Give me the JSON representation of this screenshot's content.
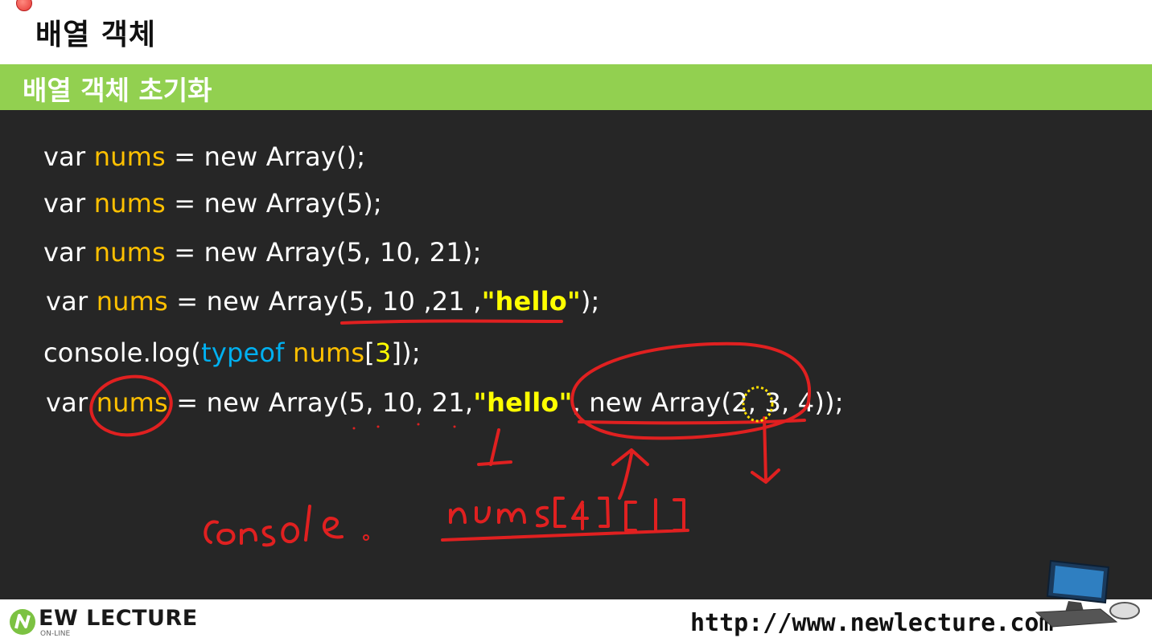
{
  "slide": {
    "title": "배열 객체",
    "section_title": "배열 객체 초기화"
  },
  "code": {
    "line1": {
      "var": "var",
      "name": "nums",
      "rest": " = new Array();"
    },
    "line2": {
      "var": "var",
      "name": "nums",
      "rest": " = new Array(5);"
    },
    "line3": {
      "var": "var",
      "name": "nums",
      "rest": " = new Array(5, 10, 21);"
    },
    "line4": {
      "var": "var",
      "name": "nums",
      "pre": " = new Array(5, 10 ,21 ,",
      "str": "\"hello\"",
      "post": ");"
    },
    "line5": {
      "pre": "console.log(",
      "typeof": "typeof",
      "name": "nums",
      "open": "[",
      "idx": "3",
      "post": "]);"
    },
    "line6": {
      "var": "var",
      "name": "nums",
      "pre": " = new Array(5, 10, 21,",
      "str": "\"hello\"",
      "post": ", new Array(2, 3, 4));"
    }
  },
  "annotations": {
    "handwriting_1": "console.",
    "handwriting_2": "nums[4][1]"
  },
  "footer": {
    "logo_text": "EW LECTURE",
    "logo_sub": "ON-LINE",
    "url": "http://www.newlecture.com"
  },
  "colors": {
    "accent_green": "#92d050",
    "code_bg": "#262626",
    "var_name": "#ffc000",
    "keyword_typeof": "#00b0f0",
    "string": "#ffff00",
    "ink": "#e02020"
  }
}
